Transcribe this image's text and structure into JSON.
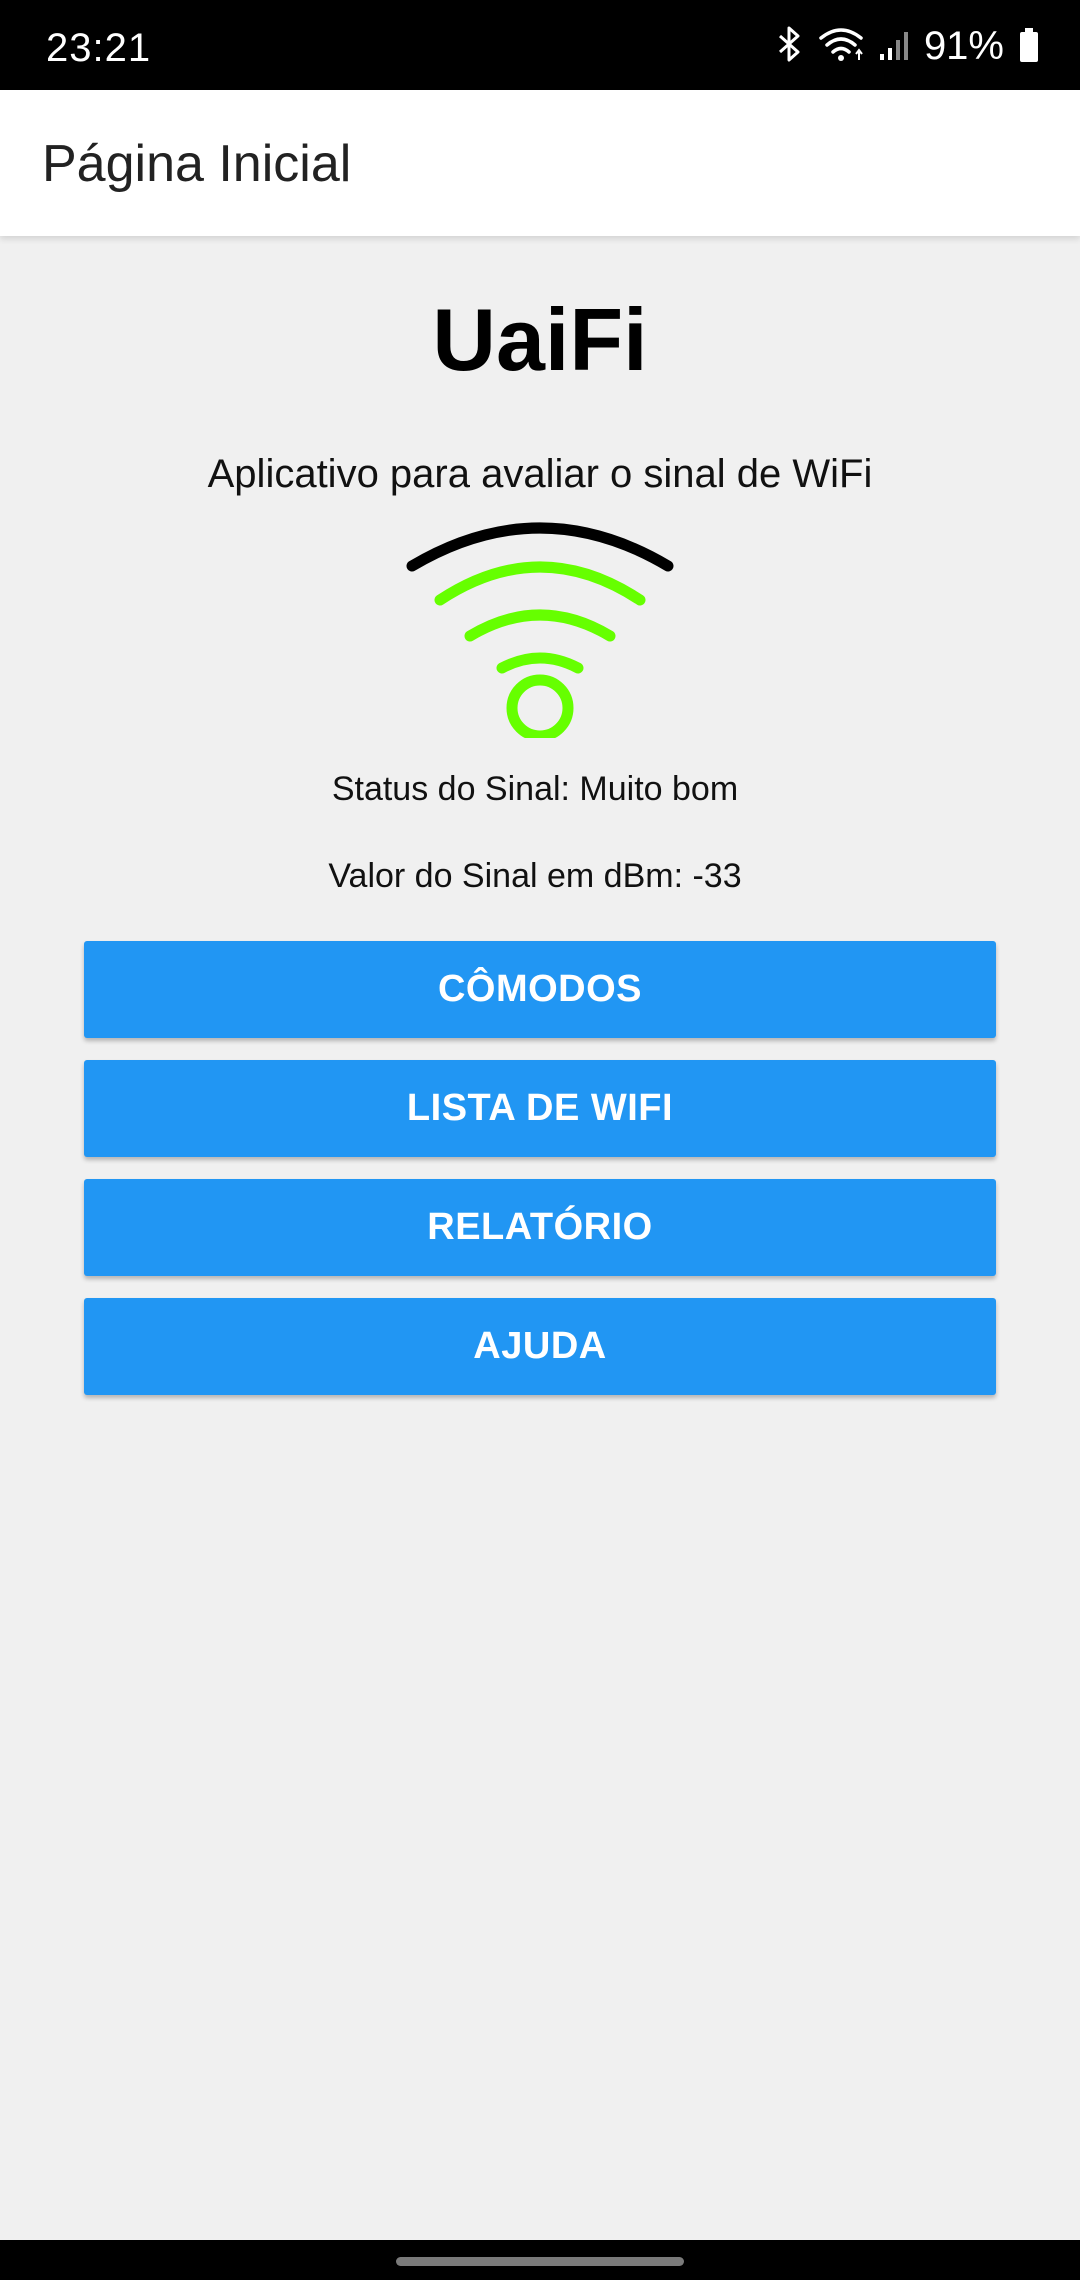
{
  "status_bar": {
    "time": "23:21",
    "battery_percent": "91%",
    "icons": [
      "bluetooth-icon",
      "wifi-status-icon",
      "cellular-signal-icon",
      "battery-icon"
    ]
  },
  "app_bar": {
    "title": "Página Inicial"
  },
  "main": {
    "brand": "UaiFi",
    "subtitle": "Aplicativo para avaliar o sinal de WiFi",
    "signal_icon": "wifi-signal-icon",
    "signal_status": "Status do Sinal: Muito bom",
    "signal_value": "Valor do Sinal em dBm: -33"
  },
  "buttons": {
    "rooms": "CÔMODOS",
    "wifi_list": "LISTA DE WIFI",
    "report": "RELATÓRIO",
    "help": "AJUDA"
  },
  "colors": {
    "primary_button": "#2196f3",
    "signal_active": "#66ff00",
    "signal_inactive": "#000000"
  }
}
